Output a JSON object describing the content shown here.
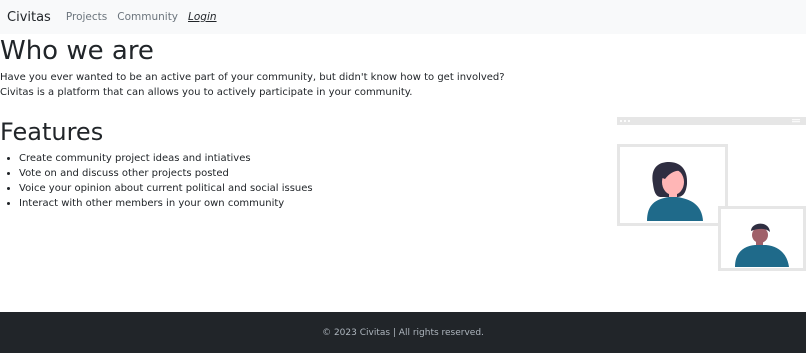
{
  "nav": {
    "brand": "Civitas",
    "links": [
      "Projects",
      "Community"
    ],
    "login": "Login"
  },
  "about": {
    "heading": "Who we are",
    "lines": [
      "Have you ever wanted to be an active part of your community, but didn't know how to get involved?",
      "Civitas is a platform that can allows you to actively participate in your community."
    ]
  },
  "features": {
    "heading": "Features",
    "items": [
      "Create community project ideas and intiatives",
      "Vote on and discuss other projects posted",
      "Voice your opinion about current political and social issues",
      "Interact with other members in your own community"
    ]
  },
  "illustration": {
    "name": "video-call-illustration",
    "colors": {
      "frame": "#e6e6e6",
      "shirt": "#1f6a8a",
      "hair": "#2f2e41",
      "skin_light": "#ffb6b6",
      "skin_dark": "#a0616a"
    }
  },
  "footer": {
    "text": "© 2023 Civitas | All rights reserved."
  }
}
